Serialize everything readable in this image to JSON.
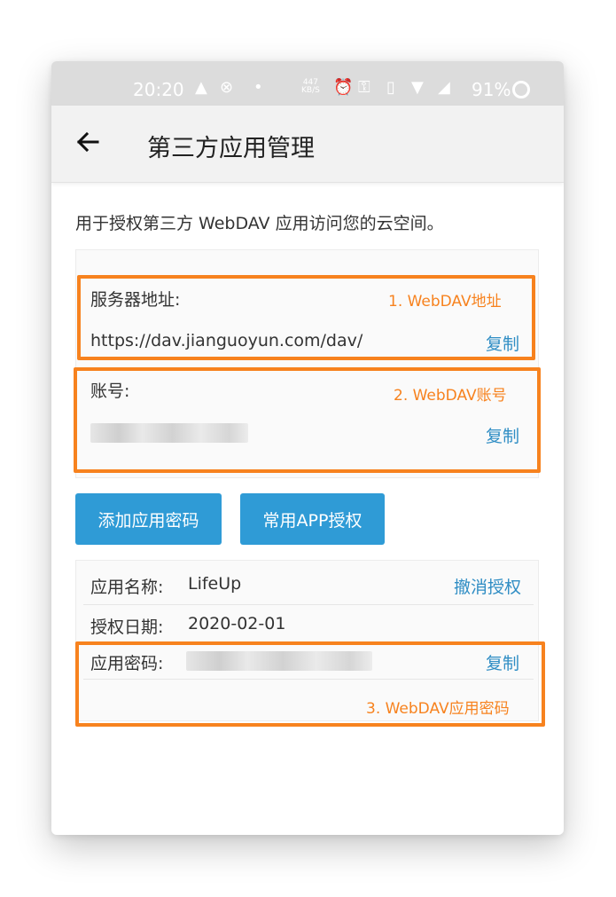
{
  "status_bar": {
    "time": "20:20",
    "net_speed_value": "447",
    "net_speed_unit": "KB/S",
    "battery": "91%",
    "icons": [
      "warning-icon",
      "blocked-icon",
      "dot-icon",
      "alarm-icon",
      "key-icon",
      "vibrate-icon",
      "wifi-icon",
      "signal-4g-icon",
      "battery-ring-icon"
    ]
  },
  "app_bar": {
    "title": "第三方应用管理"
  },
  "description": "用于授权第三方 WebDAV 应用访问您的云空间。",
  "server": {
    "label": "服务器地址:",
    "url": "https://dav.jianguoyun.com/dav/",
    "copy_label": "复制"
  },
  "account": {
    "label": "账号:",
    "copy_label": "复制"
  },
  "buttons": {
    "add_password": "添加应用密码",
    "common_app_auth": "常用APP授权"
  },
  "app_entry": {
    "name_label": "应用名称:",
    "name_value": "LifeUp",
    "revoke_label": "撤消授权",
    "date_label": "授权日期:",
    "date_value": "2020-02-01",
    "password_label": "应用密码:",
    "copy_label": "复制"
  },
  "annotations": {
    "a1": "1. WebDAV地址",
    "a2": "2. WebDAV账号",
    "a3": "3. WebDAV应用密码"
  },
  "colors": {
    "accent": "#2f9bd6",
    "link": "#2f8dc4",
    "annotation": "#f7821e"
  }
}
